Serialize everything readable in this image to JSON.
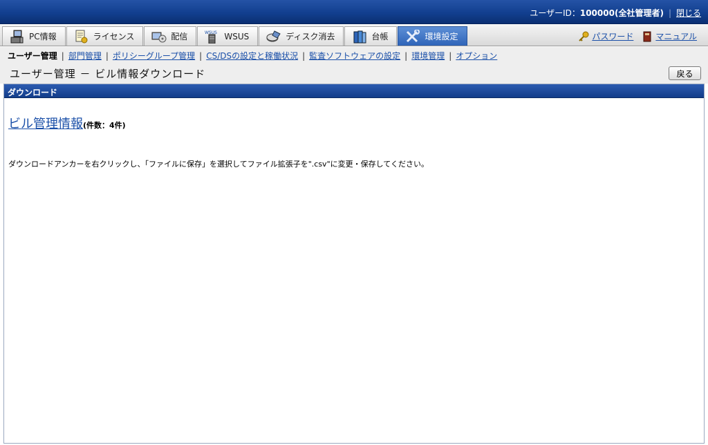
{
  "header": {
    "user_label": "ユーザーID：",
    "user_value": "100000(全社管理者)",
    "close_label": "閉じる"
  },
  "tabs": [
    {
      "label": "PC情報",
      "icon": "pc-icon"
    },
    {
      "label": "ライセンス",
      "icon": "license-icon"
    },
    {
      "label": "配信",
      "icon": "distribution-icon"
    },
    {
      "label": "WSUS",
      "icon": "wsus-server-icon",
      "icon_text": "WSUS"
    },
    {
      "label": "ディスク消去",
      "icon": "disk-erase-icon"
    },
    {
      "label": "台帳",
      "icon": "ledger-icon"
    },
    {
      "label": "環境設定",
      "icon": "tools-icon",
      "active": true
    }
  ],
  "right_links": {
    "password": "パスワード",
    "manual": "マニュアル"
  },
  "subnav": {
    "current": "ユーザー管理",
    "links": [
      "部門管理",
      "ポリシーグループ管理",
      "CS/DSの設定と稼働状況",
      "監査ソフトウェアの設定",
      "環境管理",
      "オプション"
    ]
  },
  "page": {
    "title": "ユーザー管理 － ビル情報ダウンロード",
    "back_label": "戻る"
  },
  "section": {
    "header": "ダウンロード",
    "link_text": "ビル管理情報",
    "count_text": "(件数：4件)",
    "instruction": "ダウンロードアンカーを右クリックし、「ファイルに保存」を選択してファイル拡張子を\".csv\"に変更・保存してください。"
  },
  "colors": {
    "header_blue": "#123f8f",
    "active_tab": "#2f64b8",
    "link": "#1a4fa8"
  }
}
